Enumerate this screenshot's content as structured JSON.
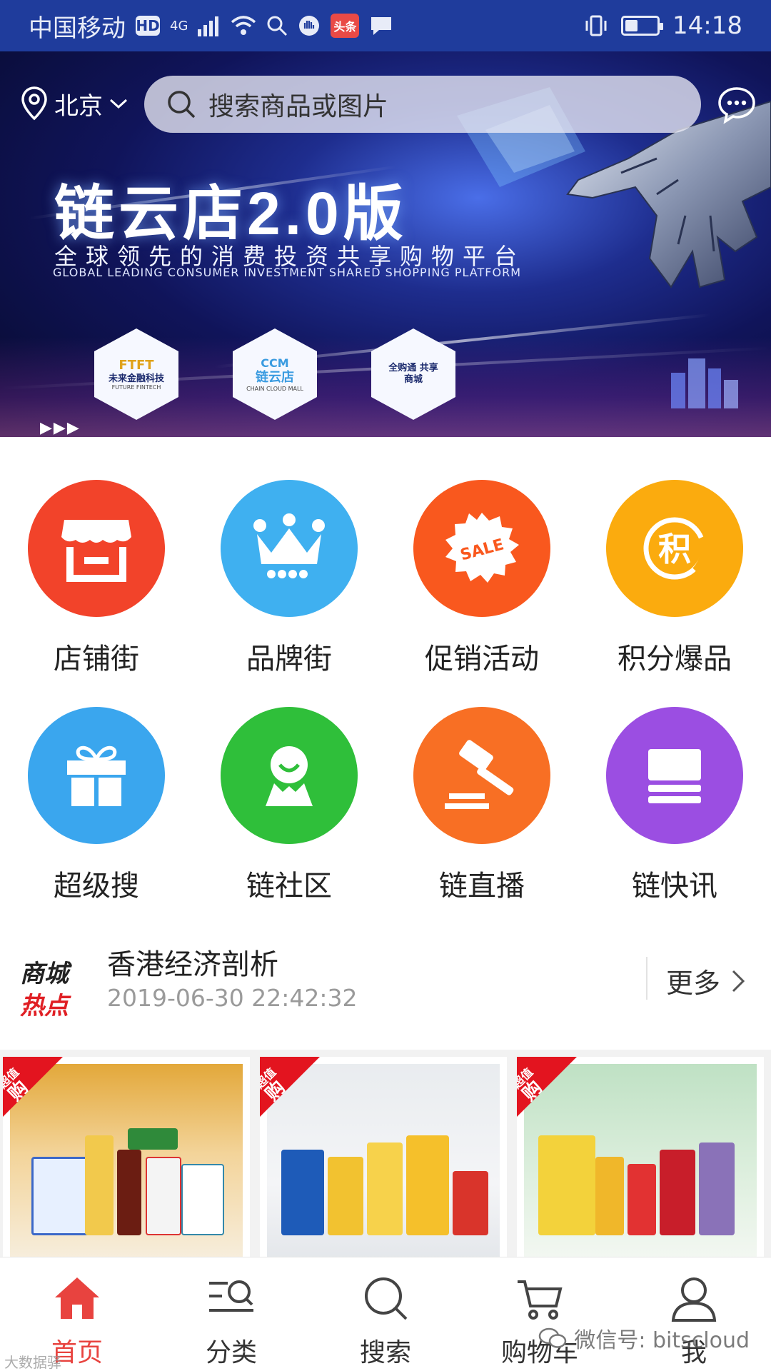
{
  "status_bar": {
    "carrier": "中国移动",
    "hd_badge": "HD",
    "network": "4G",
    "toutiao_badge": "头条",
    "time": "14:18",
    "battery_level": 0.35
  },
  "header": {
    "location": "北京",
    "search_placeholder": "搜索商品或图片"
  },
  "banner": {
    "title": "链云店2.0版",
    "subtitle": "全球领先的消费投资共享购物平台",
    "subtitle_en": "GLOBAL LEADING CONSUMER INVESTMENT SHARED SHOPPING PLATFORM",
    "logos": [
      {
        "name": "FTFT",
        "label": "未来金融科技",
        "sub": "FUTURE FINTECH"
      },
      {
        "name": "CCM",
        "label": "链云店",
        "sub": "CHAIN CLOUD MALL"
      },
      {
        "name": "全购通",
        "label": "全购通 共享商城",
        "sub": ""
      }
    ],
    "slide_index": 0,
    "slide_count": 3
  },
  "categories": [
    {
      "label": "店铺街",
      "icon": "store-icon",
      "color": "#f2432a"
    },
    {
      "label": "品牌街",
      "icon": "crown-icon",
      "color": "#3fb0f0"
    },
    {
      "label": "促销活动",
      "icon": "sale-icon",
      "color": "#f9581e"
    },
    {
      "label": "积分爆品",
      "icon": "points-icon",
      "color": "#fbab0e"
    },
    {
      "label": "超级搜",
      "icon": "gift-icon",
      "color": "#3aa6ee"
    },
    {
      "label": "链社区",
      "icon": "community-icon",
      "color": "#2fbf3a"
    },
    {
      "label": "链直播",
      "icon": "gavel-icon",
      "color": "#f86f24"
    },
    {
      "label": "链快讯",
      "icon": "news-icon",
      "color": "#9b4ee2"
    }
  ],
  "headline": {
    "logo_line1": "商城",
    "logo_line2": "热点",
    "title": "香港经济剖析",
    "time": "2019-06-30 22:42:32",
    "more": "更多"
  },
  "products": {
    "ribbon_top": "超值",
    "ribbon_big": "购"
  },
  "tabbar": [
    {
      "label": "首页",
      "icon": "home-icon",
      "active": true
    },
    {
      "label": "分类",
      "icon": "category-icon",
      "active": false
    },
    {
      "label": "搜索",
      "icon": "search-icon",
      "active": false
    },
    {
      "label": "购物车",
      "icon": "cart-icon",
      "active": false
    },
    {
      "label": "我",
      "icon": "user-icon",
      "active": false
    }
  ],
  "watermarks": {
    "right": "微信号: bitscloud",
    "left": "大数据驿"
  },
  "colors": {
    "status_bar": "#1f3c9c",
    "accent_red": "#e8433f",
    "dot_active": "#2d6be0"
  }
}
